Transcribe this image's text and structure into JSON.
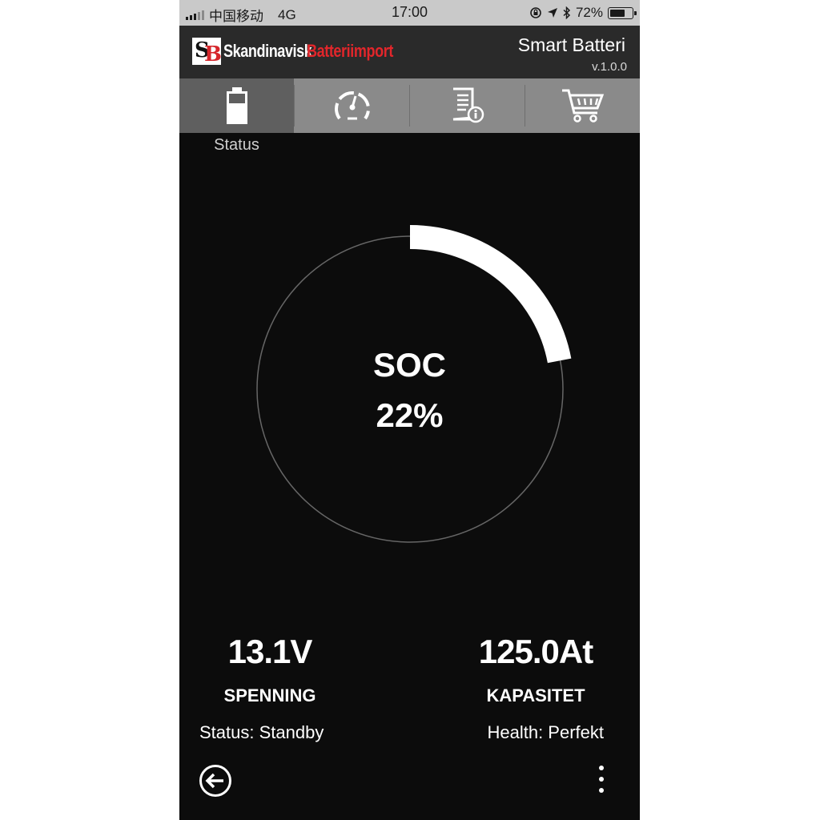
{
  "status_bar": {
    "carrier": "中国移动",
    "network": "4G",
    "time": "17:00",
    "battery_percent": "72%",
    "battery_level": 0.72,
    "icons": [
      "signal-icon",
      "rotation-lock-icon",
      "location-icon",
      "bluetooth-icon",
      "battery-icon"
    ]
  },
  "header": {
    "logo_text_1": "Skandinavisk",
    "logo_text_2": "Batteriimport",
    "title": "Smart Batteri",
    "version": "v.1.0.0"
  },
  "tabs": [
    {
      "icon": "battery-icon",
      "label": "Status",
      "active": true
    },
    {
      "icon": "speedometer-icon",
      "label": "",
      "active": false
    },
    {
      "icon": "document-info-icon",
      "label": "",
      "active": false
    },
    {
      "icon": "shopping-cart-icon",
      "label": "",
      "active": false
    }
  ],
  "soc": {
    "label": "SOC",
    "value_text": "22%",
    "fraction": 0.22
  },
  "stats": {
    "voltage_value": "13.1V",
    "voltage_label": "SPENNING",
    "capacity_value": "125.0At",
    "capacity_label": "KAPASITET",
    "status_text": "Status: Standby",
    "health_text": "Health: Perfekt"
  },
  "colors": {
    "background": "#0c0c0c",
    "header": "#2a2a2a",
    "tabbar": "#8a8a8a",
    "tab_active": "#5f5f5f",
    "brand_red": "#e2262b",
    "gauge_arc": "#ffffff",
    "gauge_ring": "#666666"
  }
}
